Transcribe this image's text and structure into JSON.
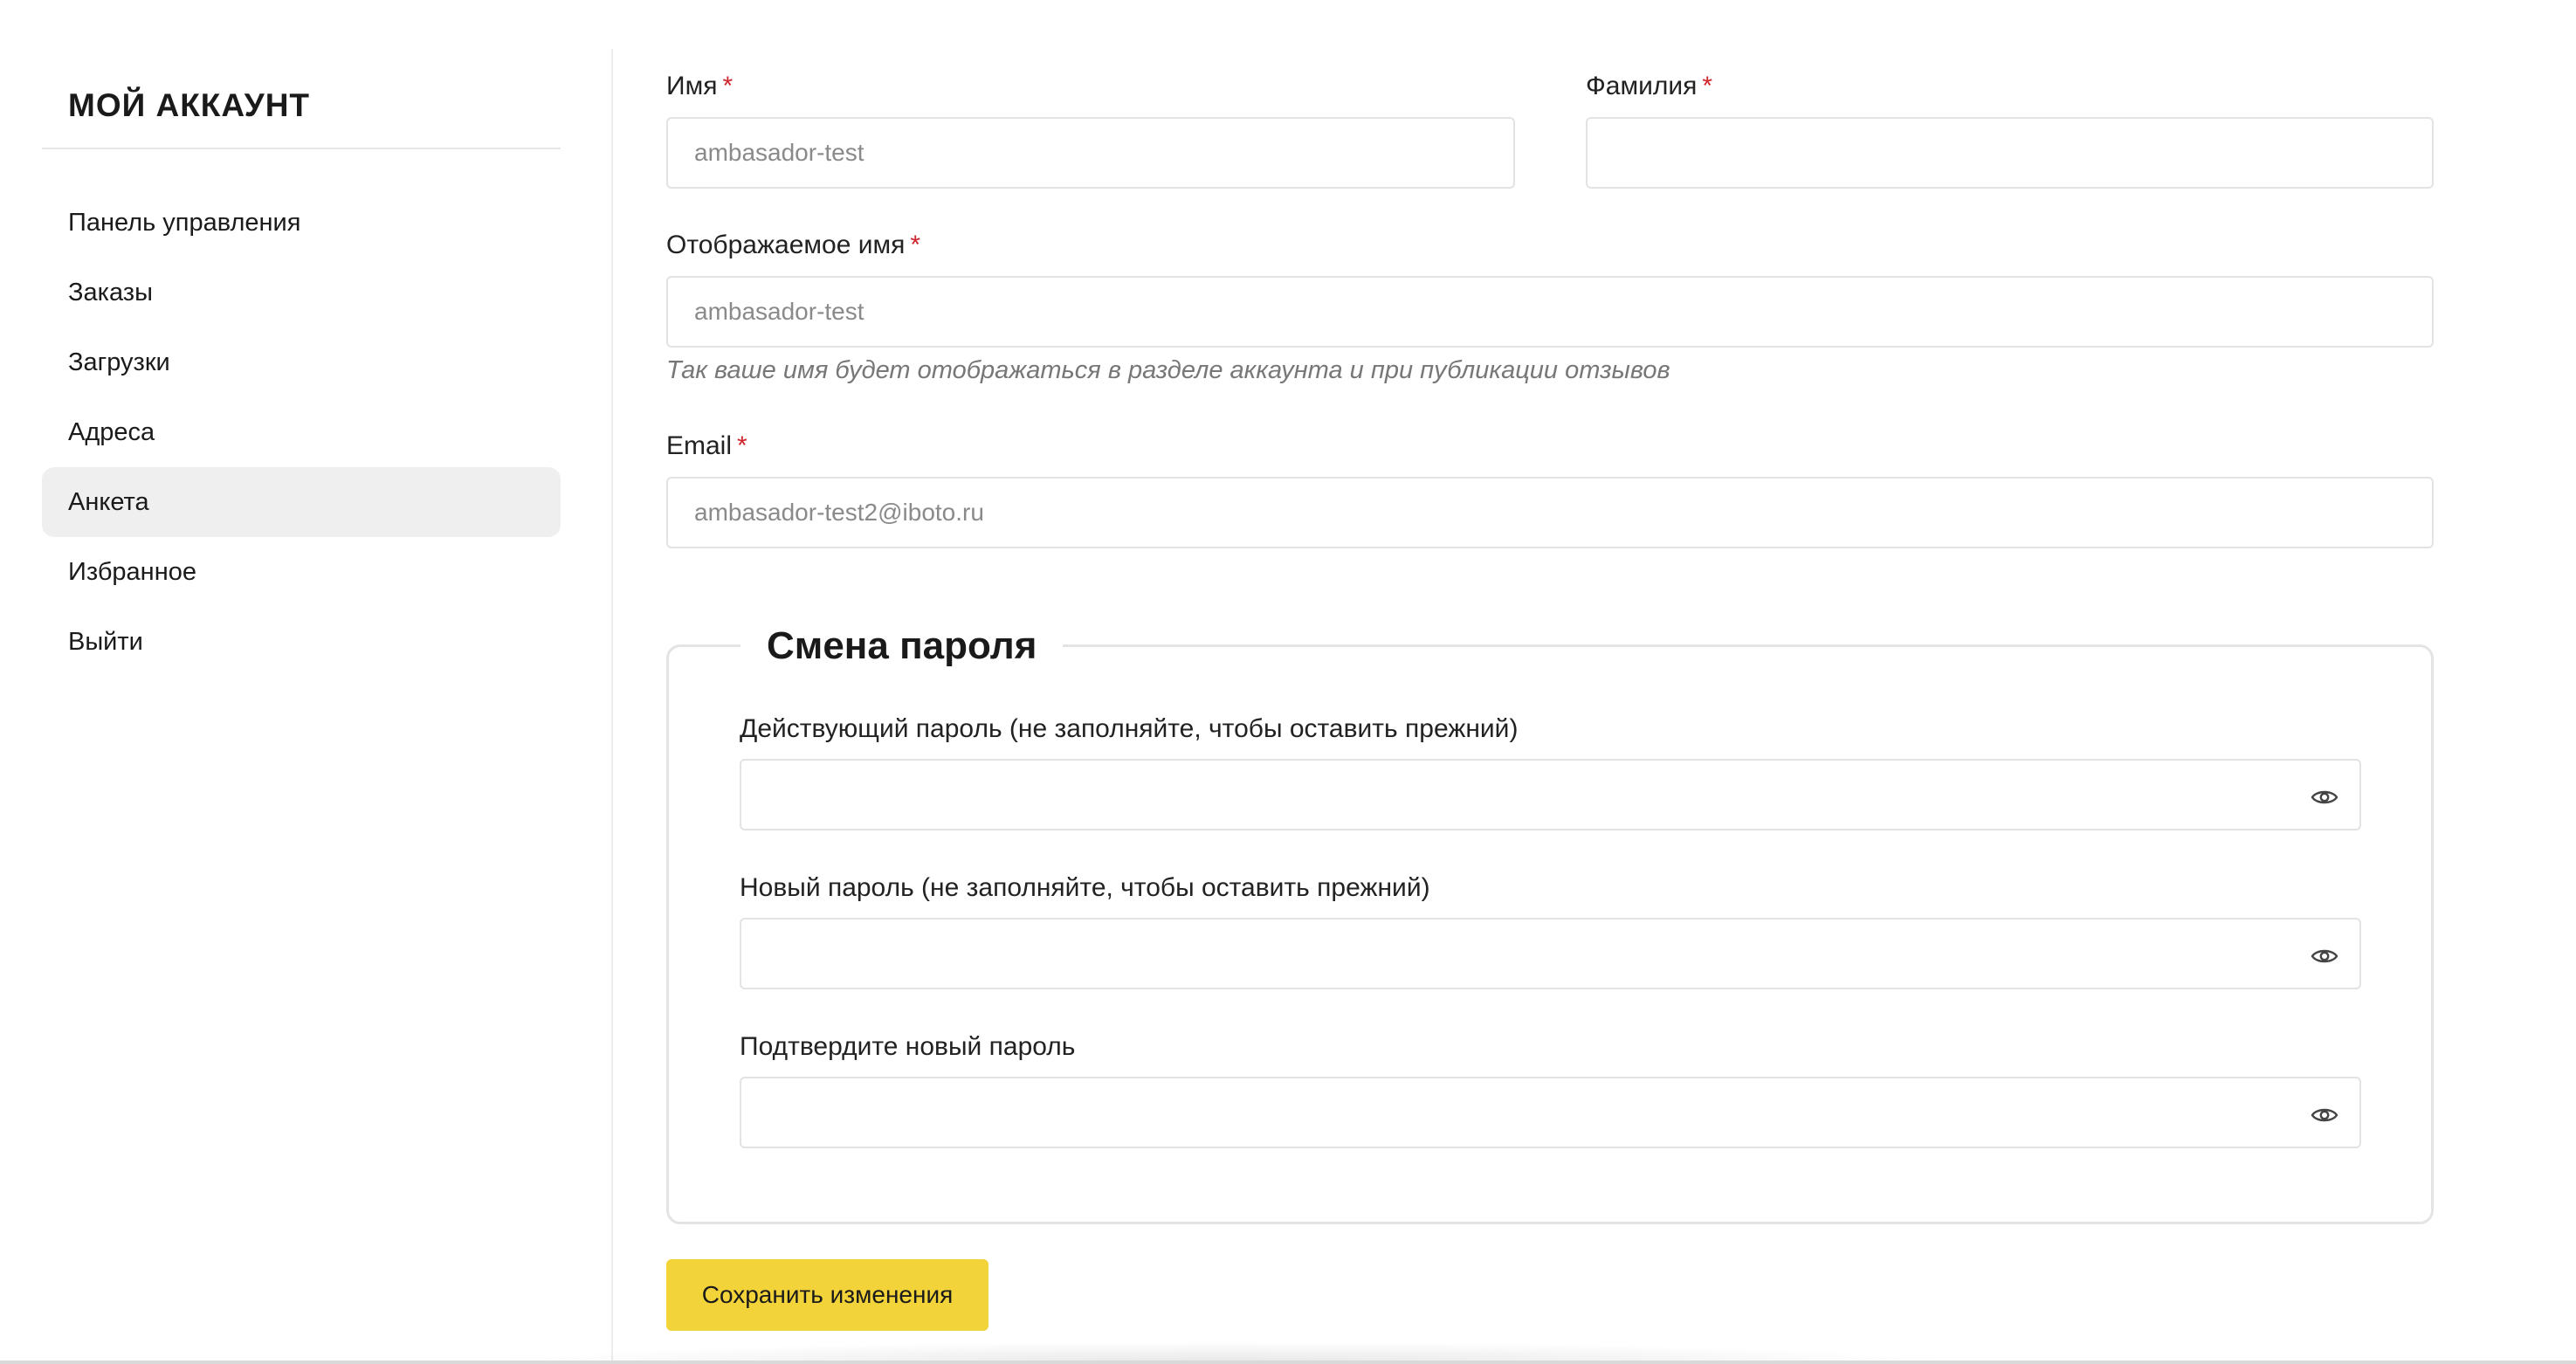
{
  "sidebar": {
    "title": "МОЙ АККАУНТ",
    "items": [
      {
        "label": "Панель управления"
      },
      {
        "label": "Заказы"
      },
      {
        "label": "Загрузки"
      },
      {
        "label": "Адреса"
      },
      {
        "label": "Анкета",
        "active": true
      },
      {
        "label": "Избранное"
      },
      {
        "label": "Выйти"
      }
    ]
  },
  "form": {
    "first_name": {
      "label": "Имя",
      "required_mark": "*",
      "value": "ambasador-test"
    },
    "last_name": {
      "label": "Фамилия",
      "required_mark": "*",
      "value": ""
    },
    "display_name": {
      "label": "Отображаемое имя",
      "required_mark": "*",
      "value": "ambasador-test",
      "hint": "Так ваше имя будет отображаться в разделе аккаунта и при публикации отзывов"
    },
    "email": {
      "label": "Email",
      "required_mark": "*",
      "value": "ambasador-test2@iboto.ru"
    },
    "password_section": {
      "legend": "Смена пароля",
      "current_password": {
        "label": "Действующий пароль (не заполняйте, чтобы оставить прежний)",
        "icon": "eye-icon"
      },
      "new_password": {
        "label": "Новый пароль (не заполняйте, чтобы оставить прежний)",
        "icon": "eye-icon"
      },
      "confirm_password": {
        "label": "Подтвердите новый пароль",
        "icon": "eye-icon"
      }
    },
    "save_label": "Сохранить изменения"
  },
  "colors": {
    "accent": "#f3d33a",
    "required": "#d0242b",
    "active_item_bg": "#efefef"
  }
}
